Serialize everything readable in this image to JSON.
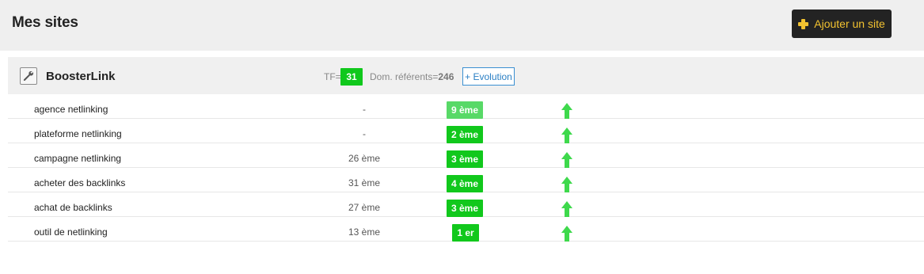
{
  "header": {
    "title": "Mes sites",
    "add_site_label": "Ajouter un site",
    "accent_color": "#f2c230"
  },
  "site": {
    "name": "BoosterLink",
    "tf_label": "TF=",
    "tf_value": "31",
    "referents_label": "Dom. référents=",
    "referents_value": "246",
    "evolution_label": "+ Evolution"
  },
  "keywords": [
    {
      "keyword": "agence netlinking",
      "previous": "-",
      "rank": "9 ème",
      "trend": "up"
    },
    {
      "keyword": "plateforme netlinking",
      "previous": "-",
      "rank": "2 ème",
      "trend": "up"
    },
    {
      "keyword": "campagne netlinking",
      "previous": "26 ème",
      "rank": "3 ème",
      "trend": "up"
    },
    {
      "keyword": "acheter des backlinks",
      "previous": "31 ème",
      "rank": "4 ème",
      "trend": "up"
    },
    {
      "keyword": "achat de backlinks",
      "previous": "27 ème",
      "rank": "3 ème",
      "trend": "up"
    },
    {
      "keyword": "outil de netlinking",
      "previous": "13 ème",
      "rank": "1 er",
      "trend": "up"
    }
  ],
  "colors": {
    "rank_badge": "#11c81c",
    "rank_badge_light": "#58d967",
    "trend_up": "#3ed94c"
  }
}
